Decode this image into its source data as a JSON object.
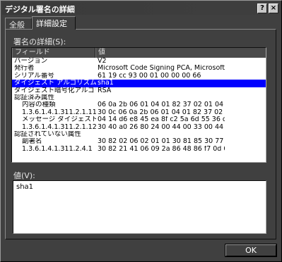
{
  "window": {
    "title": "デジタル署名の詳細",
    "help_icon": "?",
    "close_icon": "×"
  },
  "tabs": [
    {
      "label": "全般"
    },
    {
      "label": "詳細設定",
      "active": true
    }
  ],
  "details_label": "署名の詳細(S):",
  "list": {
    "columns": [
      "フィールド",
      "値"
    ],
    "rows": [
      {
        "field": "バージョン",
        "value": "V2",
        "indent": 0
      },
      {
        "field": "発行者",
        "value": "Microsoft Code Signing PCA, Microsoft...",
        "indent": 0
      },
      {
        "field": "シリアル番号",
        "value": "61 19 cc 93 00 01 00 00 00 66",
        "indent": 0
      },
      {
        "field": "ダイジェスト アルゴリズム",
        "value": "sha1",
        "indent": 0,
        "selected": true
      },
      {
        "field": "ダイジェスト暗号化アルゴリ...",
        "value": "RSA",
        "indent": 0
      },
      {
        "field": "認証済み属性",
        "value": "",
        "indent": 0
      },
      {
        "field": "内容の種類",
        "value": "06 0a 2b 06 01 04 01 82 37 02 01 04",
        "indent": 1
      },
      {
        "field": "1.3.6.1.4.1.311.2.1.11",
        "value": "30 0c 06 0a 2b 06 01 04 01 82 37 02 0...",
        "indent": 1
      },
      {
        "field": "メッセージ ダイジェスト",
        "value": "04 14 d6 e8 45 ea 8f c2 5a 6d 55 36 d...",
        "indent": 1
      },
      {
        "field": "1.3.6.1.4.1.311.2.1.12",
        "value": "30 40 a0 26 80 24 00 44 00 33 00 44 0...",
        "indent": 1
      },
      {
        "field": "認証されていない属性",
        "value": "",
        "indent": 0
      },
      {
        "field": "副署名",
        "value": "30 82 02 06 02 01 01 30 81 85 30 77 3...",
        "indent": 1
      },
      {
        "field": "1.3.6.1.4.1.311.2.4.1",
        "value": "30 82 21 41 06 09 2a 86 48 86 f7 0d 0...",
        "indent": 1
      }
    ]
  },
  "value_label": "値(V):",
  "value_text": "sha1",
  "ok_label": "OK"
}
